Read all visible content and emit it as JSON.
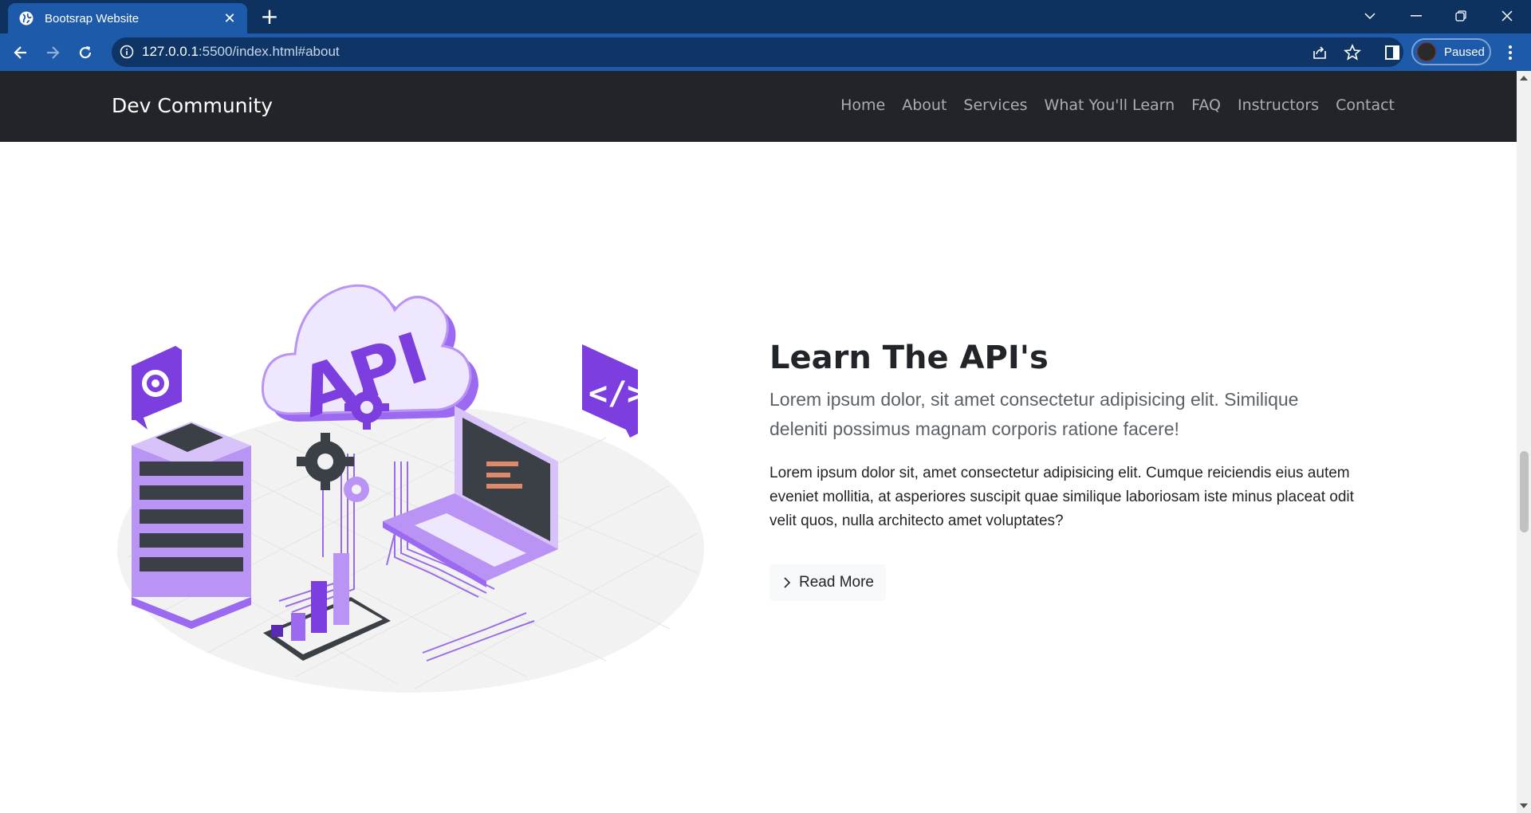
{
  "browser": {
    "tab_title": "Bootsrap Website",
    "tab_close": "✕",
    "new_tab": "+",
    "url_host": "127.0.0.1",
    "url_rest": ":5500/index.html#about",
    "profile_status": "Paused"
  },
  "navbar": {
    "brand": "Dev Community",
    "links": [
      "Home",
      "About",
      "Services",
      "What You'll Learn",
      "FAQ",
      "Instructors",
      "Contact"
    ]
  },
  "about": {
    "illustration_text": "API",
    "heading": "Learn The API's",
    "lead": "Lorem ipsum dolor, sit amet consectetur adipisicing elit. Similique deleniti possimus magnam corporis ratione facere!",
    "body": "Lorem ipsum dolor sit, amet consectetur adipisicing elit. Cumque reiciendis eius autem eveniet mollitia, at asperiores suscipit quae similique laboriosam iste minus placeat odit velit quos, nulla architecto amet voluptates?",
    "button_label": "Read More"
  },
  "colors": {
    "tabstrip": "#0e3260",
    "toolbar": "#1d5aa9",
    "navbar": "#212529",
    "accent_purple": "#7d3ee0"
  },
  "icons": [
    "globe-icon",
    "close-icon",
    "plus-icon",
    "chevron-down-icon",
    "minimize-icon",
    "restore-icon",
    "back-icon",
    "forward-icon",
    "reload-icon",
    "info-icon",
    "share-icon",
    "star-icon",
    "sidepanel-icon",
    "menu-icon",
    "chevron-right-icon"
  ]
}
